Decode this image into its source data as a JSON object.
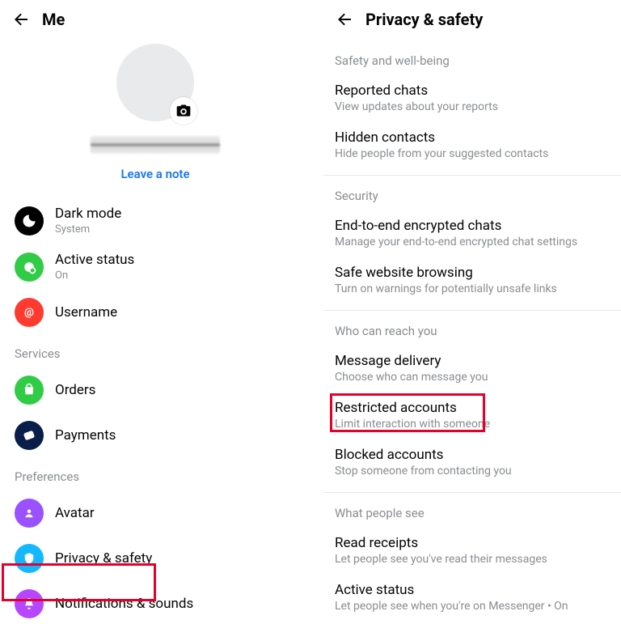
{
  "left": {
    "title": "Me",
    "leave_note": "Leave a note",
    "items": [
      {
        "title": "Dark mode",
        "sub": "System",
        "bg": "#000000",
        "icon": "moon"
      },
      {
        "title": "Active status",
        "sub": "On",
        "bg": "#31cc46",
        "icon": "active"
      },
      {
        "title": "Username",
        "sub": "",
        "bg": "#ff3b30",
        "icon": "at"
      }
    ],
    "services_label": "Services",
    "services": [
      {
        "title": "Orders",
        "bg": "#31cc46",
        "icon": "bag"
      },
      {
        "title": "Payments",
        "bg": "#0a1e4a",
        "icon": "card"
      }
    ],
    "prefs_label": "Preferences",
    "prefs": [
      {
        "title": "Avatar",
        "bg": "#9b51ff",
        "icon": "avatar"
      },
      {
        "title": "Privacy & safety",
        "bg": "#14b8ff",
        "icon": "shield"
      },
      {
        "title": "Notifications & sounds",
        "bg": "#b646ff",
        "icon": "bell"
      }
    ]
  },
  "right": {
    "title": "Privacy & safety",
    "sections": [
      {
        "label": "Safety and well-being",
        "items": [
          {
            "title": "Reported chats",
            "sub": "View updates about your reports"
          },
          {
            "title": "Hidden contacts",
            "sub": "Hide people from your suggested contacts"
          }
        ]
      },
      {
        "label": "Security",
        "items": [
          {
            "title": "End-to-end encrypted chats",
            "sub": "Manage your end-to-end encrypted chat settings"
          },
          {
            "title": "Safe website browsing",
            "sub": "Turn on warnings for potentially unsafe links"
          }
        ]
      },
      {
        "label": "Who can reach you",
        "items": [
          {
            "title": "Message delivery",
            "sub": "Choose who can message you"
          },
          {
            "title": "Restricted accounts",
            "sub": "Limit interaction with someone",
            "highlight": true
          },
          {
            "title": "Blocked accounts",
            "sub": "Stop someone from contacting you"
          }
        ]
      },
      {
        "label": "What people see",
        "items": [
          {
            "title": "Read receipts",
            "sub": "Let people see you've read their messages"
          },
          {
            "title": "Active status",
            "sub": "Let people see when you're on Messenger • On"
          }
        ]
      }
    ]
  }
}
